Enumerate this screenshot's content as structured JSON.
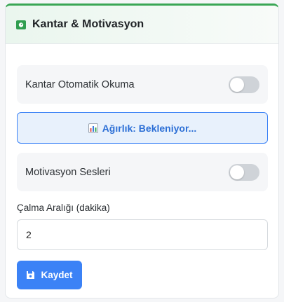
{
  "header": {
    "title": "Kantar & Motivasyon",
    "icon": "scale-icon",
    "accent_color": "#3aa655"
  },
  "auto_read": {
    "label": "Kantar Otomatik Okuma",
    "enabled": false
  },
  "weight": {
    "icon": "bar-chart-icon",
    "text": "Ağırlık: Bekleniyor..."
  },
  "motivation_sounds": {
    "label": "Motivasyon Sesleri",
    "enabled": false
  },
  "interval": {
    "label": "Çalma Aralığı (dakika)",
    "value": "2"
  },
  "save": {
    "label": "Kaydet",
    "icon": "floppy-disk-icon",
    "color": "#3b82f6"
  }
}
